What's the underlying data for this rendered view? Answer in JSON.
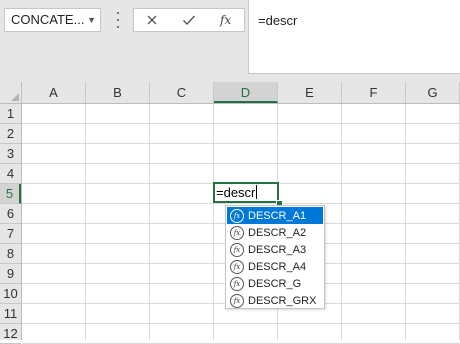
{
  "name_box": {
    "value": "CONCATE..."
  },
  "formula_bar": {
    "cancel_icon": "x-icon",
    "enter_icon": "check-icon",
    "function_icon": "fx-icon",
    "function_label": "fx",
    "value": "=descr"
  },
  "columns": [
    "A",
    "B",
    "C",
    "D",
    "E",
    "F",
    "G"
  ],
  "rows": [
    "1",
    "2",
    "3",
    "4",
    "5",
    "6",
    "7",
    "8",
    "9",
    "10",
    "11",
    "12"
  ],
  "selected": {
    "column": "D",
    "row": "5"
  },
  "active_cell": {
    "value": "=descr"
  },
  "autocomplete": {
    "icon_label": "fx",
    "items": [
      "DESCR_A1",
      "DESCR_A2",
      "DESCR_A3",
      "DESCR_A4",
      "DESCR_G",
      "DESCR_GRX"
    ],
    "selected_index": 0
  },
  "colors": {
    "accent": "#217346",
    "selection": "#0078d7",
    "header_bg": "#e6e6e6"
  }
}
